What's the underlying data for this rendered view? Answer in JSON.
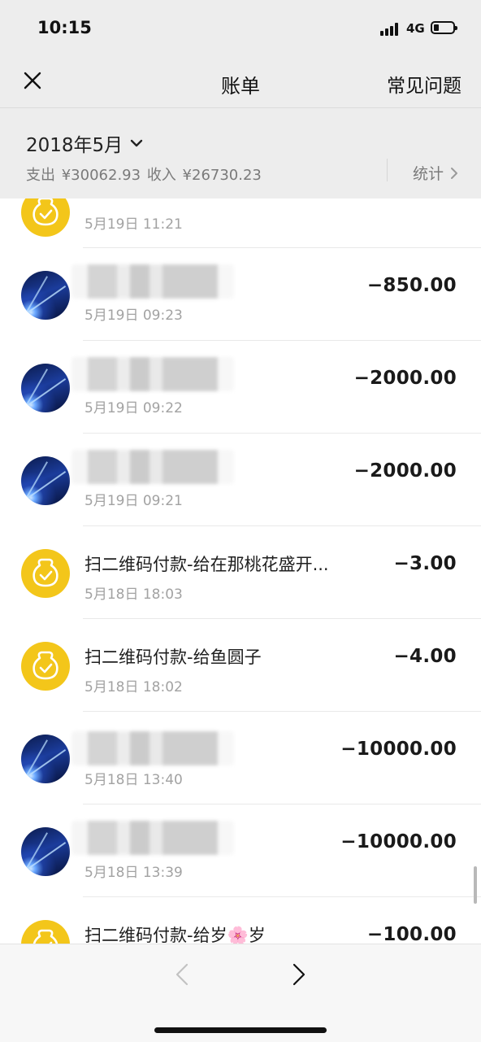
{
  "status": {
    "time": "10:15",
    "network": "4G"
  },
  "nav": {
    "title": "账单",
    "faq_label": "常见问题"
  },
  "summary": {
    "month": "2018年5月",
    "expense_label": "支出",
    "expense": "¥30062.93",
    "income_label": "收入",
    "income": "¥26730.23",
    "stats_label": "统计"
  },
  "transactions": [
    {
      "title": "",
      "time": "5月19日 11:21",
      "amount": "",
      "avatar": "gold-money-bag-icon"
    },
    {
      "title": "",
      "time": "5月19日 09:23",
      "amount": "−850.00",
      "avatar": "photo"
    },
    {
      "title": "",
      "time": "5月19日 09:22",
      "amount": "−2000.00",
      "avatar": "photo"
    },
    {
      "title": "",
      "time": "5月19日 09:21",
      "amount": "−2000.00",
      "avatar": "photo"
    },
    {
      "title": "扫二维码付款-给在那桃花盛开...",
      "time": "5月18日 18:03",
      "amount": "−3.00",
      "avatar": "gold-money-bag-icon"
    },
    {
      "title": "扫二维码付款-给鱼圆子",
      "time": "5月18日 18:02",
      "amount": "−4.00",
      "avatar": "gold-money-bag-icon"
    },
    {
      "title": "",
      "time": "5月18日 13:40",
      "amount": "−10000.00",
      "avatar": "photo"
    },
    {
      "title": "",
      "time": "5月18日 13:39",
      "amount": "−10000.00",
      "avatar": "photo"
    },
    {
      "title": "扫二维码付款-给岁🌸岁",
      "time": "",
      "amount": "−100.00",
      "avatar": "gold-money-bag-icon"
    }
  ],
  "colors": {
    "accent_gold": "#f3c61a",
    "header_bg": "#ededed"
  },
  "icons": {
    "close": "close-icon",
    "prev": "chevron-left-icon",
    "next": "chevron-right-icon"
  }
}
